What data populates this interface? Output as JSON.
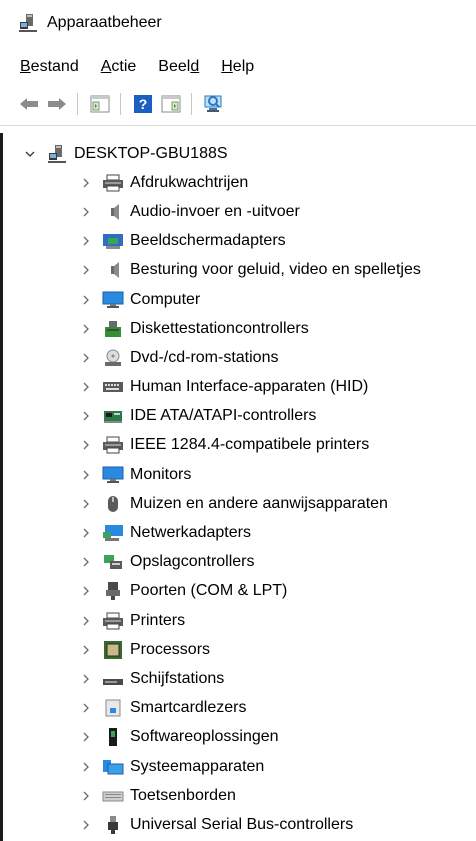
{
  "window": {
    "title": "Apparaatbeheer",
    "icon": "device-manager-icon"
  },
  "menu": [
    {
      "key": "B",
      "rest": "estand"
    },
    {
      "key": "A",
      "rest": "ctie"
    },
    {
      "pre": "Beel",
      "key": "d",
      "rest": ""
    },
    {
      "key": "H",
      "rest": "elp"
    }
  ],
  "toolbar": {
    "buttons": [
      "back-arrow-icon",
      "forward-arrow-icon",
      "properties-icon",
      "help-icon",
      "show-hidden-icon",
      "scan-hardware-icon"
    ]
  },
  "tree": {
    "root": {
      "label": "DESKTOP-GBU188S",
      "icon": "computer-tower-icon",
      "expanded": true
    },
    "children": [
      {
        "label": "Afdrukwachtrijen",
        "icon": "printer-icon"
      },
      {
        "label": "Audio-invoer en -uitvoer",
        "icon": "speaker-icon"
      },
      {
        "label": "Beeldschermadapters",
        "icon": "display-adapter-icon"
      },
      {
        "label": "Besturing voor geluid, video en spelletjes",
        "icon": "speaker-icon"
      },
      {
        "label": "Computer",
        "icon": "monitor-icon"
      },
      {
        "label": "Diskettestationcontrollers",
        "icon": "floppy-controller-icon"
      },
      {
        "label": "Dvd-/cd-rom-stations",
        "icon": "disc-icon"
      },
      {
        "label": "Human Interface-apparaten (HID)",
        "icon": "keyboard-hid-icon"
      },
      {
        "label": "IDE ATA/ATAPI-controllers",
        "icon": "ide-controller-icon"
      },
      {
        "label": "IEEE 1284.4-compatibele printers",
        "icon": "printer-icon"
      },
      {
        "label": "Monitors",
        "icon": "monitor-icon"
      },
      {
        "label": "Muizen en andere aanwijsapparaten",
        "icon": "mouse-icon"
      },
      {
        "label": "Netwerkadapters",
        "icon": "network-adapter-icon"
      },
      {
        "label": "Opslagcontrollers",
        "icon": "storage-controller-icon"
      },
      {
        "label": "Poorten (COM & LPT)",
        "icon": "port-icon"
      },
      {
        "label": "Printers",
        "icon": "printer-icon"
      },
      {
        "label": "Processors",
        "icon": "processor-icon"
      },
      {
        "label": "Schijfstations",
        "icon": "disk-drive-icon"
      },
      {
        "label": "Smartcardlezers",
        "icon": "smartcard-icon"
      },
      {
        "label": "Softwareoplossingen",
        "icon": "software-icon"
      },
      {
        "label": "Systeemapparaten",
        "icon": "system-devices-icon"
      },
      {
        "label": "Toetsenborden",
        "icon": "keyboard-icon"
      },
      {
        "label": "Universal Serial Bus-controllers",
        "icon": "usb-icon"
      }
    ]
  }
}
